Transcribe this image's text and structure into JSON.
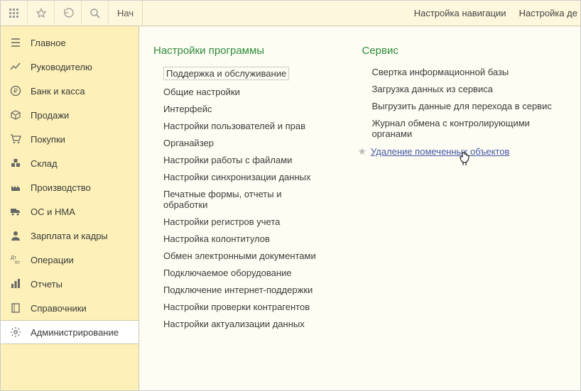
{
  "topbar": {
    "tab": "Нач",
    "navSettings": "Настройка навигации",
    "actionSettings": "Настройка де"
  },
  "sidebar": {
    "items": [
      {
        "label": "Главное",
        "icon": "home"
      },
      {
        "label": "Руководителю",
        "icon": "chart"
      },
      {
        "label": "Банк и касса",
        "icon": "ruble"
      },
      {
        "label": "Продажи",
        "icon": "cart"
      },
      {
        "label": "Покупки",
        "icon": "basket"
      },
      {
        "label": "Склад",
        "icon": "warehouse"
      },
      {
        "label": "Производство",
        "icon": "factory"
      },
      {
        "label": "ОС и НМА",
        "icon": "truck"
      },
      {
        "label": "Зарплата и кадры",
        "icon": "person"
      },
      {
        "label": "Операции",
        "icon": "ops"
      },
      {
        "label": "Отчеты",
        "icon": "report"
      },
      {
        "label": "Справочники",
        "icon": "book"
      },
      {
        "label": "Администрирование",
        "icon": "gear",
        "active": true
      }
    ]
  },
  "content": {
    "col1": {
      "title": "Настройки программы",
      "links": [
        "Поддержка и обслуживание",
        "Общие настройки",
        "Интерфейс",
        "Настройки пользователей и прав",
        "Органайзер",
        "Настройки работы с файлами",
        "Настройки синхронизации данных",
        "Печатные формы, отчеты и обработки",
        "Настройки регистров учета",
        "Настройка колонтитулов",
        "Обмен электронными документами",
        "Подключаемое оборудование",
        "Подключение интернет-поддержки",
        "Настройки проверки контрагентов",
        "Настройки актуализации данных"
      ]
    },
    "col2": {
      "title": "Сервис",
      "links": [
        "Свертка информационной базы",
        "Загрузка данных из сервиса",
        "Выгрузить данные для перехода в сервис",
        "Журнал обмена с контролирующими органами",
        "Удаление помеченных объектов"
      ]
    }
  }
}
